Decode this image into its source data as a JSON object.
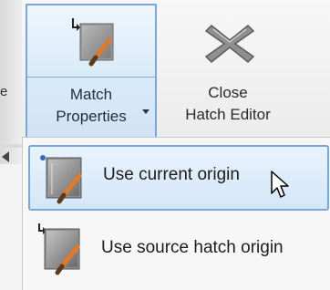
{
  "ribbon": {
    "left_edge_text": "e",
    "match_properties": {
      "line1": "Match",
      "line2": "Properties",
      "icon": "match-properties-icon",
      "has_dropdown": true
    },
    "close_hatch_editor": {
      "line1": "Close",
      "line2": "Hatch Editor",
      "icon": "close-x-icon"
    }
  },
  "menu": {
    "items": [
      {
        "label": "Use current origin",
        "icon": "use-current-origin-icon",
        "highlighted": true
      },
      {
        "label": "Use source hatch origin",
        "icon": "use-source-hatch-origin-icon",
        "highlighted": false
      }
    ]
  },
  "colors": {
    "highlight_border": "#7aa6d8",
    "highlight_fill": "#d3e6f8",
    "brush_orange": "#e07a2a"
  }
}
